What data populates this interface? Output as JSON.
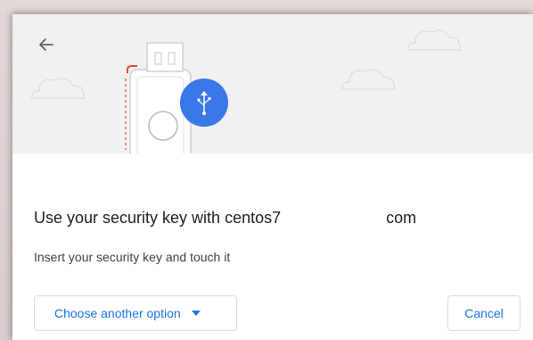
{
  "header": {
    "back_icon": "arrow-back-icon",
    "illustration_icons": [
      "usb-security-key-icon",
      "usb-symbol-icon",
      "cloud-icon"
    ]
  },
  "dialog": {
    "title_prefix": "Use your security key with centos7",
    "title_suffix": "com",
    "subtitle": "Insert your security key and touch it"
  },
  "buttons": {
    "choose_label": "Choose another option",
    "cancel_label": "Cancel"
  },
  "colors": {
    "accent": "#1a73e8",
    "usb_badge": "#3b78e7",
    "illustration_bg": "#f1f1f1",
    "text_primary": "#202124"
  }
}
